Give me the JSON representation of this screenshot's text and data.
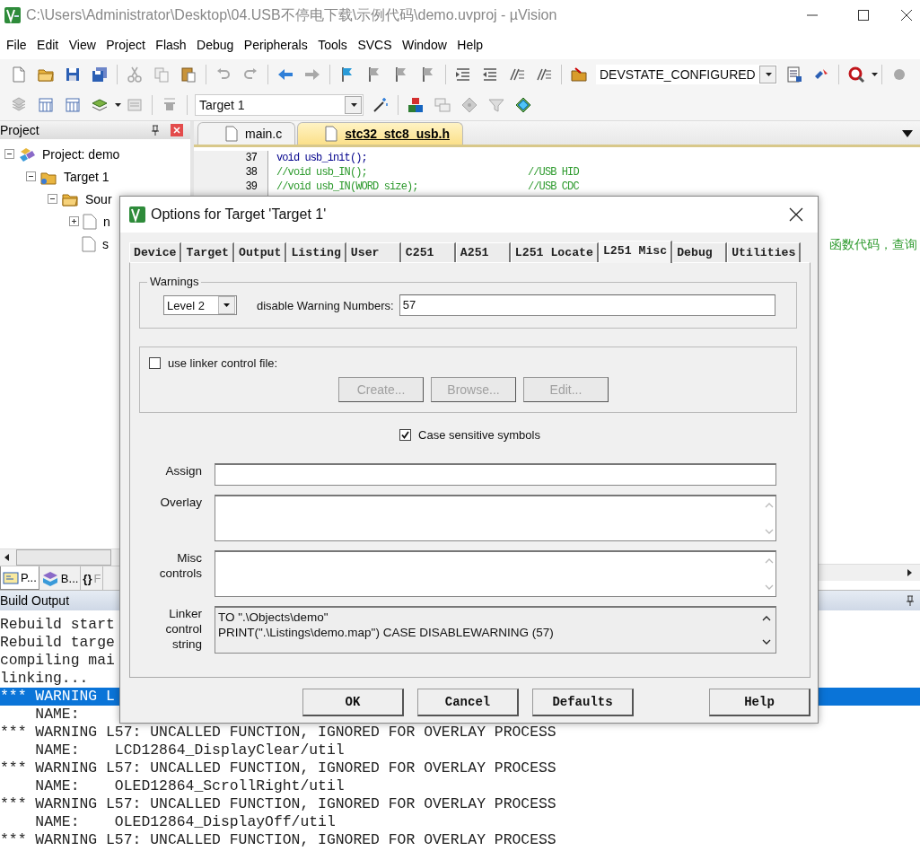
{
  "window": {
    "title": "C:\\Users\\Administrator\\Desktop\\04.USB不停电下载\\示例代码\\demo.uvproj - µVision"
  },
  "menu": [
    "File",
    "Edit",
    "View",
    "Project",
    "Flash",
    "Debug",
    "Peripherals",
    "Tools",
    "SVCS",
    "Window",
    "Help"
  ],
  "toolbar": {
    "device_state": "DEVSTATE_CONFIGURED",
    "target": "Target 1"
  },
  "project_panel": {
    "title": "Project",
    "tree": [
      {
        "label": "Project: demo",
        "kind": "project",
        "expanded": true,
        "children": [
          {
            "label": "Target 1",
            "kind": "target",
            "expanded": true,
            "children": [
              {
                "label": "Sour",
                "kind": "group",
                "expanded": true,
                "children": [
                  {
                    "label": "n",
                    "kind": "file",
                    "expanded": false
                  },
                  {
                    "label": "s",
                    "kind": "file"
                  }
                ]
              }
            ]
          }
        ]
      }
    ],
    "tabs": [
      {
        "label": "P...",
        "kind": "project",
        "selected": true
      },
      {
        "label": "B...",
        "kind": "books",
        "selected": false
      },
      {
        "label": "F",
        "glyph": "{}",
        "kind": "functions",
        "selected": false
      }
    ]
  },
  "editor": {
    "tabs": [
      {
        "label": "main.c",
        "selected": false
      },
      {
        "label": "stc32_stc8_usb.h",
        "selected": true
      }
    ],
    "lines": [
      {
        "number": "37",
        "kind": "code",
        "code": "void usb_init();"
      },
      {
        "number": "38",
        "kind": "comment",
        "code": "//void usb_IN();",
        "comment": "//USB HID"
      },
      {
        "number": "39",
        "kind": "comment",
        "code": "//void usb_IN(WORD size);",
        "comment": "//USB CDC"
      }
    ],
    "fragment": "函数代码，查询"
  },
  "build_output": {
    "title": "Build Output",
    "lines": [
      {
        "text": "Rebuild start",
        "selected": false
      },
      {
        "text": "Rebuild targe",
        "selected": false
      },
      {
        "text": "compiling mai",
        "selected": false
      },
      {
        "text": "linking...",
        "selected": false
      },
      {
        "text": "*** WARNING L",
        "selected": true
      },
      {
        "text": "    NAME:",
        "selected": false
      },
      {
        "text": "*** WARNING L57: UNCALLED FUNCTION, IGNORED FOR OVERLAY PROCESS",
        "selected": false
      },
      {
        "text": "    NAME:    LCD12864_DisplayClear/util",
        "selected": false
      },
      {
        "text": "*** WARNING L57: UNCALLED FUNCTION, IGNORED FOR OVERLAY PROCESS",
        "selected": false
      },
      {
        "text": "    NAME:    OLED12864_ScrollRight/util",
        "selected": false
      },
      {
        "text": "*** WARNING L57: UNCALLED FUNCTION, IGNORED FOR OVERLAY PROCESS",
        "selected": false
      },
      {
        "text": "    NAME:    OLED12864_DisplayOff/util",
        "selected": false
      },
      {
        "text": "*** WARNING L57: UNCALLED FUNCTION, IGNORED FOR OVERLAY PROCESS",
        "selected": false
      }
    ]
  },
  "dialog": {
    "title": "Options for Target 'Target 1'",
    "tabs": [
      {
        "label": "Device",
        "selected": false
      },
      {
        "label": "Target",
        "selected": false
      },
      {
        "label": "Output",
        "selected": false
      },
      {
        "label": "Listing",
        "selected": false
      },
      {
        "label": "User",
        "selected": false
      },
      {
        "label": "C251",
        "selected": false
      },
      {
        "label": "A251",
        "selected": false
      },
      {
        "label": "L251 Locate",
        "selected": false
      },
      {
        "label": "L251 Misc",
        "selected": true
      },
      {
        "label": "Debug",
        "selected": false
      },
      {
        "label": "Utilities",
        "selected": false
      }
    ],
    "warnings": {
      "legend": "Warnings",
      "level": "Level 2",
      "label": "disable Warning Numbers:",
      "value": "57"
    },
    "linker_file": {
      "label": "use linker control file:",
      "checked": false,
      "buttons": [
        {
          "label": "Create...",
          "disabled": true
        },
        {
          "label": "Browse...",
          "disabled": true
        },
        {
          "label": "Edit...",
          "disabled": true
        }
      ]
    },
    "case_sensitive": {
      "label": "Case sensitive symbols",
      "checked": true
    },
    "fields": [
      {
        "label": "Assign",
        "kind": "line"
      },
      {
        "label": "Overlay",
        "kind": "area"
      },
      {
        "label": "Misc controls",
        "kind": "area"
      },
      {
        "label": "Linker control string",
        "kind": "readonly",
        "lines": [
          "TO \".\\Objects\\demo\"",
          "PRINT(\".\\Listings\\demo.map\") CASE DISABLEWARNING (57)"
        ]
      }
    ],
    "buttons": [
      "OK",
      "Cancel",
      "Defaults",
      "Help"
    ]
  }
}
